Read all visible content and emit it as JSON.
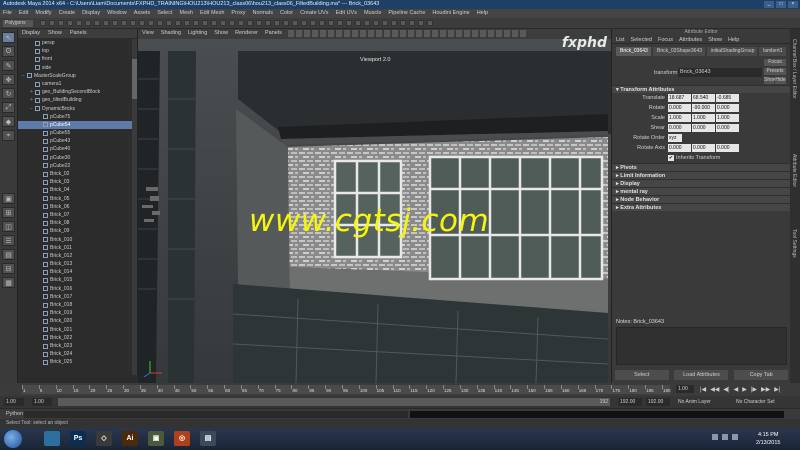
{
  "window": {
    "title": "Autodesk Maya 2014 x64 - C:\\Users\\Liam\\Documents\\FXPHD_TRAINING\\HOU213\\HOU213_class06\\hou213_class06_FiltedBuilding.ma* --- Brick_03643",
    "controls": [
      "_",
      "□",
      "×"
    ]
  },
  "menubar": [
    "File",
    "Edit",
    "Modify",
    "Create",
    "Display",
    "Window",
    "Assets",
    "Select",
    "Mesh",
    "Edit Mesh",
    "Proxy",
    "Normals",
    "Color",
    "Create UVs",
    "Edit UVs",
    "Muscle",
    "Pipeline Cache",
    "Houdini Engine",
    "Help"
  ],
  "statusline": {
    "mode": "Polygons"
  },
  "logo": "fxphd",
  "outliner": {
    "menu": [
      "Display",
      "Show",
      "Panels"
    ],
    "items": [
      {
        "label": "persp",
        "indent": 1,
        "expand": ""
      },
      {
        "label": "top",
        "indent": 1,
        "expand": ""
      },
      {
        "label": "front",
        "indent": 1,
        "expand": ""
      },
      {
        "label": "side",
        "indent": 1,
        "expand": ""
      },
      {
        "label": "MasterScaleGroup",
        "indent": 0,
        "expand": "−"
      },
      {
        "label": "camera1",
        "indent": 1,
        "expand": ""
      },
      {
        "label": "geo_BuildingSecondBlock",
        "indent": 1,
        "expand": "+"
      },
      {
        "label": "geo_tiltedBuilding",
        "indent": 1,
        "expand": "+"
      },
      {
        "label": "DynamicBricks",
        "indent": 1,
        "expand": "−"
      },
      {
        "label": "pCube75",
        "indent": 2,
        "expand": ""
      },
      {
        "label": "pCube54",
        "indent": 2,
        "expand": "",
        "selected": true
      },
      {
        "label": "pCube55",
        "indent": 2,
        "expand": ""
      },
      {
        "label": "pCube43",
        "indent": 2,
        "expand": ""
      },
      {
        "label": "pCube40",
        "indent": 2,
        "expand": ""
      },
      {
        "label": "pCube30",
        "indent": 2,
        "expand": ""
      },
      {
        "label": "pCube22",
        "indent": 2,
        "expand": ""
      },
      {
        "label": "Brick_02",
        "indent": 2,
        "expand": ""
      },
      {
        "label": "Brick_03",
        "indent": 2,
        "expand": ""
      },
      {
        "label": "Brick_04",
        "indent": 2,
        "expand": ""
      },
      {
        "label": "Brick_05",
        "indent": 2,
        "expand": ""
      },
      {
        "label": "Brick_06",
        "indent": 2,
        "expand": ""
      },
      {
        "label": "Brick_07",
        "indent": 2,
        "expand": ""
      },
      {
        "label": "Brick_08",
        "indent": 2,
        "expand": ""
      },
      {
        "label": "Brick_09",
        "indent": 2,
        "expand": ""
      },
      {
        "label": "Brick_010",
        "indent": 2,
        "expand": ""
      },
      {
        "label": "Brick_011",
        "indent": 2,
        "expand": ""
      },
      {
        "label": "Brick_012",
        "indent": 2,
        "expand": ""
      },
      {
        "label": "Brick_013",
        "indent": 2,
        "expand": ""
      },
      {
        "label": "Brick_014",
        "indent": 2,
        "expand": ""
      },
      {
        "label": "Brick_015",
        "indent": 2,
        "expand": ""
      },
      {
        "label": "Brick_016",
        "indent": 2,
        "expand": ""
      },
      {
        "label": "Brick_017",
        "indent": 2,
        "expand": ""
      },
      {
        "label": "Brick_018",
        "indent": 2,
        "expand": ""
      },
      {
        "label": "Brick_019",
        "indent": 2,
        "expand": ""
      },
      {
        "label": "Brick_020",
        "indent": 2,
        "expand": ""
      },
      {
        "label": "Brick_021",
        "indent": 2,
        "expand": ""
      },
      {
        "label": "Brick_022",
        "indent": 2,
        "expand": ""
      },
      {
        "label": "Brick_023",
        "indent": 2,
        "expand": ""
      },
      {
        "label": "Brick_024",
        "indent": 2,
        "expand": ""
      },
      {
        "label": "Brick_025",
        "indent": 2,
        "expand": ""
      }
    ]
  },
  "viewport": {
    "menu": [
      "View",
      "Shading",
      "Lighting",
      "Show",
      "Renderer",
      "Panels"
    ],
    "name": "Viewport 2.0",
    "watermark": "www.cgtsj.com"
  },
  "attribute_editor": {
    "title": "Attribute Editor",
    "menu": [
      "List",
      "Selected",
      "Focus",
      "Attributes",
      "Show",
      "Help"
    ],
    "tabs": [
      "Brick_03643",
      "Brick_03Shape3643",
      "initialShadingGroup",
      "lambert1"
    ],
    "transform_label": "transform:",
    "transform_value": "Brick_03643",
    "buttons": {
      "focus": "Focus",
      "presets": "Presets",
      "show": "Show",
      "hide": "Hide"
    },
    "sections": {
      "transform": "Transform Attributes",
      "collapsed": [
        "Pivots",
        "Limit Information",
        "Display",
        "mental ray",
        "Node Behavior",
        "Extra Attributes"
      ]
    },
    "fields": [
      {
        "label": "Translate",
        "values": [
          "18.687",
          "68.540",
          "-0.685"
        ]
      },
      {
        "label": "Rotate",
        "values": [
          "0.000",
          "-90.000",
          "0.000"
        ]
      },
      {
        "label": "Scale",
        "values": [
          "1.000",
          "1.000",
          "1.000"
        ]
      },
      {
        "label": "Shear",
        "values": [
          "0.000",
          "0.000",
          "0.000"
        ]
      }
    ],
    "rotate_order": {
      "label": "Rotate Order",
      "value": "xyz"
    },
    "rotate_axis": {
      "label": "Rotate Axis",
      "values": [
        "0.000",
        "0.000",
        "0.000"
      ]
    },
    "inherits": {
      "label": "Inherits Transform",
      "checked": "✔"
    },
    "notes_label": "Notes:  Brick_03643",
    "bottom_buttons": [
      "Select",
      "Load Attributes",
      "Copy Tab"
    ]
  },
  "side_strip": [
    "Channel Box / Layer Editor",
    "Attribute Editor",
    "Tool Settings"
  ],
  "timeline": {
    "ticks": [
      "1",
      "5",
      "10",
      "15",
      "20",
      "25",
      "30",
      "35",
      "40",
      "45",
      "50",
      "55",
      "60",
      "65",
      "70",
      "75",
      "80",
      "85",
      "90",
      "95",
      "100",
      "105",
      "110",
      "115",
      "120",
      "125",
      "130",
      "135",
      "140",
      "145",
      "150",
      "155",
      "160",
      "165",
      "170",
      "175",
      "180",
      "185",
      "190"
    ],
    "current_frame": "1.00",
    "play_controls": [
      "|◀",
      "◀◀",
      "◀|",
      "◀",
      "▶",
      "|▶",
      "▶▶",
      "▶|"
    ]
  },
  "range": {
    "start": "1.00",
    "start_inner": "1.00",
    "bar_label": "192",
    "end_inner": "192.00",
    "end": "192.00",
    "anim_layer": "No Anim Layer",
    "char_set": "No Character Set"
  },
  "commandline": {
    "label": "Python"
  },
  "helpline": "Select Tool: select an object",
  "taskbar": {
    "apps": [
      {
        "label": "",
        "color": "#2c6e9c"
      },
      {
        "label": "Ps",
        "color": "#0b2d52"
      },
      {
        "label": "◇",
        "color": "#3a3a3a"
      },
      {
        "label": "Ai",
        "color": "#4a2a08"
      },
      {
        "label": "▣",
        "color": "#4a5a3a"
      },
      {
        "label": "◎",
        "color": "#b0401a"
      },
      {
        "label": "▤",
        "color": "#3a4a5a"
      }
    ],
    "time": "4:15 PM",
    "date": "2/13/2015"
  }
}
